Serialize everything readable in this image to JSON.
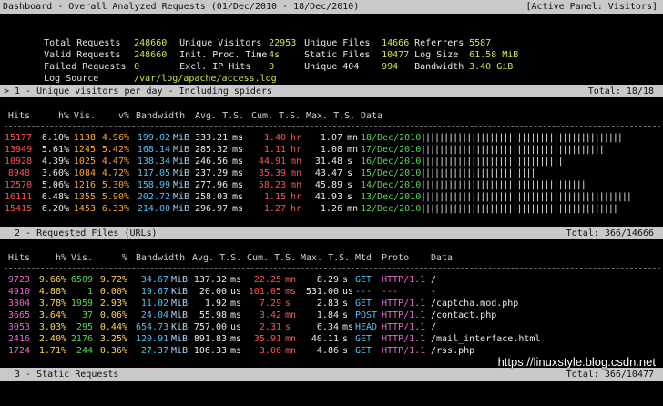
{
  "titlebar": {
    "left": "Dashboard - Overall Analyzed Requests (01/Dec/2010 - 18/Dec/2010)",
    "right": "[Active Panel: Visitors]"
  },
  "summary": [
    [
      {
        "label": "Total Requests",
        "value": "248660"
      },
      {
        "label": "Unique Visitors",
        "value": "22953"
      },
      {
        "label": "Unique Files",
        "value": "14666"
      },
      {
        "label": "Referrers",
        "value": "5587"
      }
    ],
    [
      {
        "label": "Valid Requests",
        "value": "248660"
      },
      {
        "label": "Init. Proc. Time",
        "value": "4s"
      },
      {
        "label": "Static Files",
        "value": "10477"
      },
      {
        "label": "Log Size",
        "value": "61.58 MiB"
      }
    ],
    [
      {
        "label": "Failed Requests",
        "value": "0"
      },
      {
        "label": "Excl. IP Hits",
        "value": "0"
      },
      {
        "label": "Unique 404",
        "value": "994"
      },
      {
        "label": "Bandwidth",
        "value": "3.40 GiB"
      }
    ],
    [
      {
        "label": "Log Source",
        "value": "/var/log/apache/access.log"
      }
    ]
  ],
  "panel1": {
    "title": "> 1 - Unique visitors per day - Including spiders",
    "total": "Total: 18/18",
    "columns": {
      "hits": "Hits",
      "hpct": "h%",
      "vis": "Vis.",
      "vpct": "v%",
      "bw": "Bandwidth",
      "avg": "Avg. T.S.",
      "cum": "Cum. T.S.",
      "max": "Max. T.S.",
      "data": "Data"
    },
    "rows": [
      {
        "hits": "15177",
        "hpct": "6.10%",
        "vis": "1138",
        "vpct": "4.96%",
        "bw": "199.02",
        "bwu": "MiB",
        "avg": "333.21",
        "avgu": "ms",
        "cum": "1.40",
        "cumu": "hr",
        "max": "1.07",
        "maxu": "mn",
        "date": "18/Dec/2010",
        "bar": 44
      },
      {
        "hits": "13949",
        "hpct": "5.61%",
        "vis": "1245",
        "vpct": "5.42%",
        "bw": "168.14",
        "bwu": "MiB",
        "avg": "285.32",
        "avgu": "ms",
        "cum": "1.11",
        "cumu": "hr",
        "max": "1.08",
        "maxu": "mn",
        "date": "17/Dec/2010",
        "bar": 40
      },
      {
        "hits": "10928",
        "hpct": "4.39%",
        "vis": "1025",
        "vpct": "4.47%",
        "bw": "138.34",
        "bwu": "MiB",
        "avg": "246.56",
        "avgu": "ms",
        "cum": "44.91",
        "cumu": "mn",
        "max": "31.48",
        "maxu": "s",
        "date": "16/Dec/2010",
        "bar": 31
      },
      {
        "hits": "8948",
        "hpct": "3.60%",
        "vis": "1084",
        "vpct": "4.72%",
        "bw": "117.05",
        "bwu": "MiB",
        "avg": "237.29",
        "avgu": "ms",
        "cum": "35.39",
        "cumu": "mn",
        "max": "43.47",
        "maxu": "s",
        "date": "15/Dec/2010",
        "bar": 25
      },
      {
        "hits": "12570",
        "hpct": "5.06%",
        "vis": "1216",
        "vpct": "5.30%",
        "bw": "158.99",
        "bwu": "MiB",
        "avg": "277.96",
        "avgu": "ms",
        "cum": "58.23",
        "cumu": "mn",
        "max": "45.89",
        "maxu": "s",
        "date": "14/Dec/2010",
        "bar": 36
      },
      {
        "hits": "16111",
        "hpct": "6.48%",
        "vis": "1355",
        "vpct": "5.90%",
        "bw": "202.72",
        "bwu": "MiB",
        "avg": "258.03",
        "avgu": "ms",
        "cum": "1.15",
        "cumu": "hr",
        "max": "41.93",
        "maxu": "s",
        "date": "13/Dec/2010",
        "bar": 46
      },
      {
        "hits": "15415",
        "hpct": "6.20%",
        "vis": "1453",
        "vpct": "6.33%",
        "bw": "214.00",
        "bwu": "MiB",
        "avg": "296.97",
        "avgu": "ms",
        "cum": "1.27",
        "cumu": "hr",
        "max": "1.26",
        "maxu": "mn",
        "date": "12/Dec/2010",
        "bar": 43
      }
    ]
  },
  "panel2": {
    "title": "  2 - Requested Files (URLs)",
    "total": "Total: 366/14666",
    "columns": {
      "hits": "Hits",
      "hpct": "h%",
      "vis": "Vis.",
      "vpct": "%",
      "bw": "Bandwidth",
      "avg": "Avg. T.S.",
      "cum": "Cum. T.S.",
      "max": "Max. T.S.",
      "mtd": "Mtd",
      "proto": "Proto",
      "data": "Data"
    },
    "rows": [
      {
        "hits": "9723",
        "hpct": "9.66%",
        "vis": "6509",
        "vpct": "9.72%",
        "bw": "34.67",
        "bwu": "MiB",
        "avg": "137.32",
        "avgu": "ms",
        "cum": "22.25",
        "cumu": "mn",
        "max": "8.29",
        "maxu": "s",
        "mtd": "GET",
        "proto": "HTTP/1.1",
        "data": "/"
      },
      {
        "hits": "4910",
        "hpct": "4.88%",
        "vis": "1",
        "vpct": "0.00%",
        "bw": "19.67",
        "bwu": "KiB",
        "avg": "20.00",
        "avgu": "us",
        "cum": "101.05",
        "cumu": "ms",
        "max": "531.00",
        "maxu": "us",
        "mtd": "---",
        "proto": "---",
        "data": "-"
      },
      {
        "hits": "3804",
        "hpct": "3.78%",
        "vis": "1959",
        "vpct": "2.93%",
        "bw": "11.02",
        "bwu": "MiB",
        "avg": "1.92",
        "avgu": "ms",
        "cum": "7.29",
        "cumu": "s",
        "max": "2.83",
        "maxu": "s",
        "mtd": "GET",
        "proto": "HTTP/1.1",
        "data": "/captcha.mod.php"
      },
      {
        "hits": "3665",
        "hpct": "3.64%",
        "vis": "37",
        "vpct": "0.06%",
        "bw": "24.04",
        "bwu": "MiB",
        "avg": "55.98",
        "avgu": "ms",
        "cum": "3.42",
        "cumu": "mn",
        "max": "1.84",
        "maxu": "s",
        "mtd": "POST",
        "proto": "HTTP/1.1",
        "data": "/contact.php"
      },
      {
        "hits": "3053",
        "hpct": "3.03%",
        "vis": "295",
        "vpct": "0.44%",
        "bw": "654.73",
        "bwu": "KiB",
        "avg": "757.00",
        "avgu": "us",
        "cum": "2.31",
        "cumu": "s",
        "max": "6.34",
        "maxu": "ms",
        "mtd": "HEAD",
        "proto": "HTTP/1.1",
        "data": "/"
      },
      {
        "hits": "2416",
        "hpct": "2.40%",
        "vis": "2176",
        "vpct": "3.25%",
        "bw": "120.91",
        "bwu": "MiB",
        "avg": "891.83",
        "avgu": "ms",
        "cum": "35.91",
        "cumu": "mn",
        "max": "40.11",
        "maxu": "s",
        "mtd": "GET",
        "proto": "HTTP/1.1",
        "data": "/mail_interface.html"
      },
      {
        "hits": "1724",
        "hpct": "1.71%",
        "vis": "244",
        "vpct": "0.36%",
        "bw": "27.37",
        "bwu": "MiB",
        "avg": "106.33",
        "avgu": "ms",
        "cum": "3.06",
        "cumu": "mn",
        "max": "4.86",
        "maxu": "s",
        "mtd": "GET",
        "proto": "HTTP/1.1",
        "data": "/rss.php"
      }
    ]
  },
  "panel3": {
    "title": "  3 - Static Requests",
    "total": "Total: 366/10477"
  },
  "watermark": "https://linuxstyle.blog.csdn.net",
  "colors": {
    "hits": "#ff5252",
    "visitors": "#ffa726",
    "bandwidth": "#4fc3f7",
    "date": "#5bd45b",
    "proto": "#e36bd0",
    "summary_value": "#d7e04a",
    "header_bg": "#c9c9c9"
  }
}
